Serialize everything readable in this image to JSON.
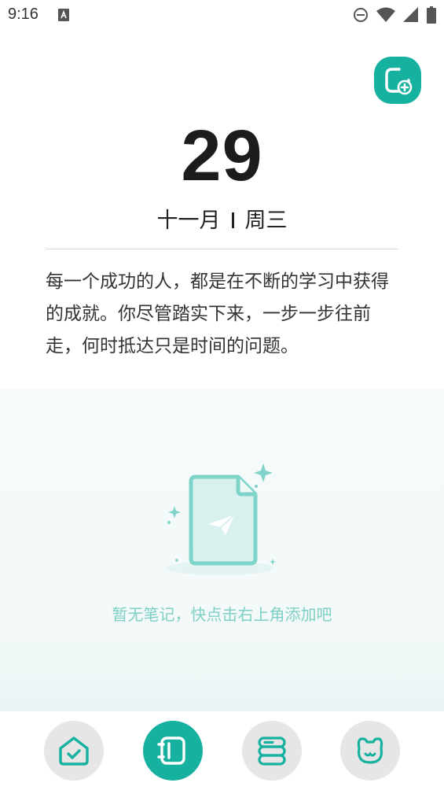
{
  "status_bar": {
    "time": "9:16"
  },
  "header": {
    "day": "29",
    "month": "十一月",
    "weekday": "周三"
  },
  "quote": "每一个成功的人，都是在不断的学习中获得的成就。你尽管踏实下来，一步一步往前走，何时抵达只是时间的问题。",
  "empty_state": {
    "message": "暂无笔记，快点击右上角添加吧"
  },
  "bottom_nav": {
    "items": [
      {
        "icon": "home-check-icon",
        "active": false
      },
      {
        "icon": "notebook-icon",
        "active": true
      },
      {
        "icon": "layers-icon",
        "active": false
      },
      {
        "icon": "bear-face-icon",
        "active": false
      }
    ]
  },
  "colors": {
    "accent": "#17b1a0",
    "accent_light": "#7ed0c6",
    "nav_inactive": "#e6e6e6"
  }
}
